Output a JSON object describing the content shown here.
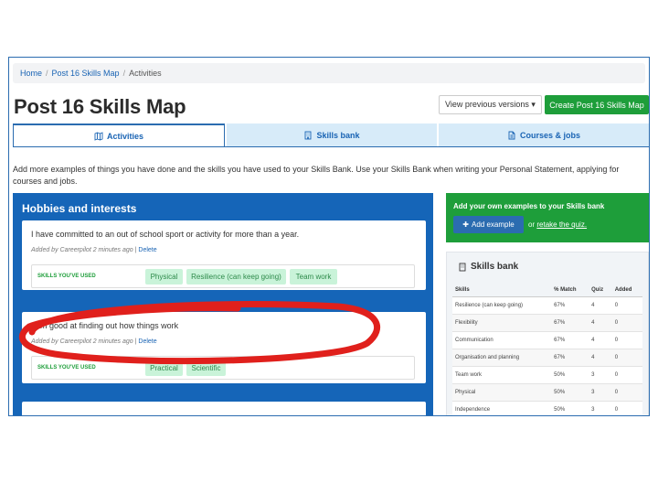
{
  "breadcrumb": {
    "home": "Home",
    "skills_map": "Post 16 Skills Map",
    "current": "Activities",
    "sep": "/"
  },
  "page_title": "Post 16 Skills Map",
  "header_buttons": {
    "view_versions": "View previous versions ▾",
    "create": "Create Post 16 Skills Map"
  },
  "tabs": [
    {
      "label": "Activities",
      "icon": "map-icon",
      "active": true
    },
    {
      "label": "Skills bank",
      "icon": "building-icon",
      "active": false
    },
    {
      "label": "Courses & jobs",
      "icon": "document-icon",
      "active": false
    }
  ],
  "intro": "Add more examples of things you have done and the skills you have used to your Skills Bank. Use your Skills Bank when writing your Personal Statement, applying for courses and jobs.",
  "hobbies": {
    "title": "Hobbies and interests",
    "cards": [
      {
        "title": "I have committed to an out of school sport or activity for more than a year.",
        "meta": "Added by Careerpilot 2 minutes ago |",
        "delete": "Delete",
        "skills_label": "SKILLS YOU'VE USED",
        "skills": [
          "Physical",
          "Resilience (can keep going)",
          "Team work"
        ]
      },
      {
        "title": "I am good at finding out how things work",
        "meta": "Added by Careerpilot 2 minutes ago |",
        "delete": "Delete",
        "skills_label": "SKILLS YOU'VE USED",
        "skills": [
          "Practical",
          "Scientific"
        ]
      }
    ]
  },
  "add_examples": {
    "title": "Add your own examples to your Skills bank",
    "button": "Add example",
    "or": "or",
    "retake": "retake the quiz."
  },
  "skills_bank": {
    "title": "Skills bank",
    "columns": [
      "Skills",
      "% Match",
      "Quiz",
      "Added"
    ],
    "rows": [
      [
        "Resilience (can keep going)",
        "67%",
        "4",
        "0"
      ],
      [
        "Flexibility",
        "67%",
        "4",
        "0"
      ],
      [
        "Communication",
        "67%",
        "4",
        "0"
      ],
      [
        "Organisation and planning",
        "67%",
        "4",
        "0"
      ],
      [
        "Team work",
        "50%",
        "3",
        "0"
      ],
      [
        "Physical",
        "50%",
        "3",
        "0"
      ],
      [
        "Independence",
        "50%",
        "3",
        "0"
      ]
    ]
  },
  "colors": {
    "primary_blue": "#1565b8",
    "green": "#1e9e3a",
    "tag_bg": "#c9f3d9",
    "annotation_red": "#e0201c"
  }
}
